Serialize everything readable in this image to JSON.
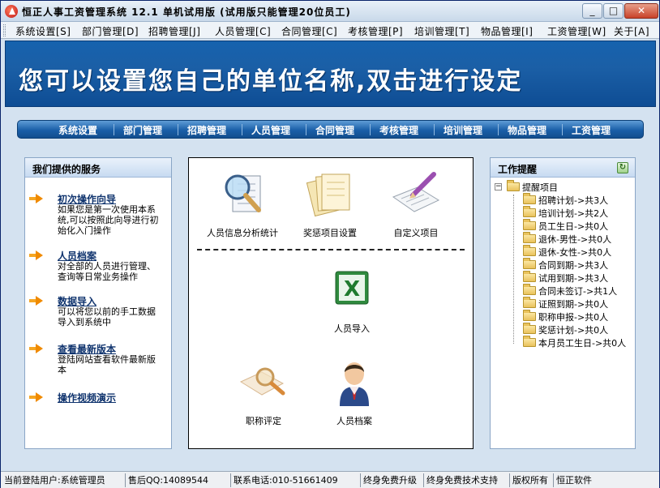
{
  "window": {
    "title": "恒正人事工资管理系统 12.1 单机试用版 (试用版只能管理20位员工)",
    "min_label": "_",
    "max_label": "□",
    "close_label": "✕"
  },
  "menu": [
    "系统设置[S]",
    "部门管理[D]",
    "招聘管理[J]",
    "人员管理[C]",
    "合同管理[C]",
    "考核管理[P]",
    "培训管理[T]",
    "物品管理[I]",
    "工资管理[W]",
    "关于[A]"
  ],
  "banner": {
    "text": "您可以设置您自己的单位名称,双击进行设定"
  },
  "nav": [
    "系统设置",
    "部门管理",
    "招聘管理",
    "人员管理",
    "合同管理",
    "考核管理",
    "培训管理",
    "物品管理",
    "工资管理"
  ],
  "services": {
    "title": "我们提供的服务",
    "items": [
      {
        "title": "初次操作向导",
        "desc": "如果您是第一次使用本系统,可以按照此向导进行初始化入门操作"
      },
      {
        "title": "人员档案",
        "desc": "对全部的人员进行管理、查询等日常业务操作"
      },
      {
        "title": "数据导入",
        "desc": "可以将您以前的手工数据导入到系统中"
      },
      {
        "title": "查看最新版本",
        "desc": "登陆网站查看软件最新版本"
      },
      {
        "title": "操作视频演示",
        "desc": ""
      }
    ]
  },
  "center": {
    "tiles": [
      {
        "label": "人员信息分析统计",
        "icon": "magnifier-document-icon"
      },
      {
        "label": "奖惩项目设置",
        "icon": "documents-stack-icon"
      },
      {
        "label": "自定义项目",
        "icon": "pencil-paper-icon"
      },
      {
        "label": "人员导入",
        "icon": "excel-icon"
      },
      {
        "label": "职称评定",
        "icon": "magnifier-icon"
      },
      {
        "label": "人员档案",
        "icon": "person-icon"
      }
    ]
  },
  "reminders": {
    "title": "工作提醒",
    "root": "提醒项目",
    "items": [
      "招聘计划->共3人",
      "培训计划->共2人",
      "员工生日->共0人",
      "退休-男性->共0人",
      "退休-女性->共0人",
      "合同到期->共3人",
      "试用到期->共3人",
      "合同未签订->共1人",
      "证照到期->共0人",
      "职称申报->共0人",
      "奖惩计划->共0人",
      "本月员工生日->共0人"
    ]
  },
  "status": {
    "user": "当前登陆用户:系统管理员",
    "qq": "售后QQ:14089544",
    "phone": "联系电话:010-51661409",
    "upgrade": "终身免费升级",
    "support": "终身免费技术支持",
    "copyright": "版权所有",
    "company": "恒正软件"
  },
  "colors": {
    "banner": "#1b5fa6",
    "nav": "#1a5fa8",
    "accent_arrow": "#f08a00"
  }
}
